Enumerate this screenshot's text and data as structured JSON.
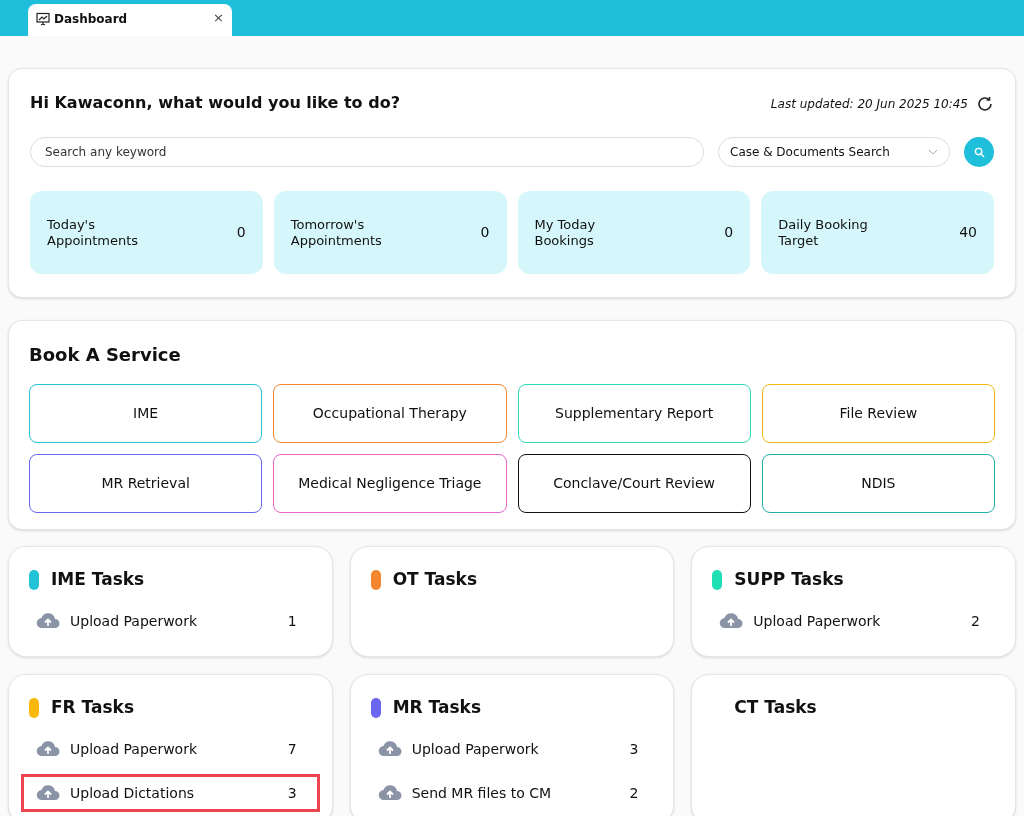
{
  "tab": {
    "label": "Dashboard",
    "close": "×"
  },
  "greeting": "Hi Kawaconn, what would you like to do?",
  "last_updated": "Last updated: 20 Jun 2025 10:45",
  "search": {
    "placeholder": "Search any keyword"
  },
  "search_type": {
    "value": "Case & Documents Search"
  },
  "stats": [
    {
      "label": "Today's Appointments",
      "value": "0"
    },
    {
      "label": "Tomorrow's Appointments",
      "value": "0"
    },
    {
      "label": "My Today Bookings",
      "value": "0"
    },
    {
      "label": "Daily Booking Target",
      "value": "40"
    }
  ],
  "book_service": {
    "title": "Book A Service",
    "services": [
      {
        "label": "IME",
        "color": "#22c3d6"
      },
      {
        "label": "Occupational Therapy",
        "color": "#f2872f"
      },
      {
        "label": "Supplementary Report",
        "color": "#2ddbb8"
      },
      {
        "label": "File Review",
        "color": "#f6b80f"
      },
      {
        "label": "MR Retrieval",
        "color": "#6a66f0"
      },
      {
        "label": "Medical Negligence Triage",
        "color": "#e964c7"
      },
      {
        "label": "Conclave/Court Review",
        "color": "#111111"
      },
      {
        "label": "NDIS",
        "color": "#1fb0a8"
      }
    ]
  },
  "task_groups": [
    {
      "title": "IME Tasks",
      "color": "#22c3d6",
      "tasks": [
        {
          "label": "Upload Paperwork",
          "count": "1",
          "highlighted": false
        }
      ]
    },
    {
      "title": "OT Tasks",
      "color": "#f2872f"
    },
    {
      "title": "SUPP Tasks",
      "color": "#1fe0b5",
      "tasks": [
        {
          "label": "Upload Paperwork",
          "count": "2",
          "highlighted": false
        }
      ]
    },
    {
      "title": "FR Tasks",
      "color": "#fbb80c",
      "tasks": [
        {
          "label": "Upload Paperwork",
          "count": "7",
          "highlighted": false
        },
        {
          "label": "Upload Dictations",
          "count": "3",
          "highlighted": true
        }
      ]
    },
    {
      "title": "MR Tasks",
      "color": "#6a66f0",
      "tasks": [
        {
          "label": "Upload Paperwork",
          "count": "3",
          "highlighted": false
        },
        {
          "label": "Send MR files to CM",
          "count": "2",
          "highlighted": false
        }
      ]
    },
    {
      "title": "CT Tasks"
    }
  ]
}
